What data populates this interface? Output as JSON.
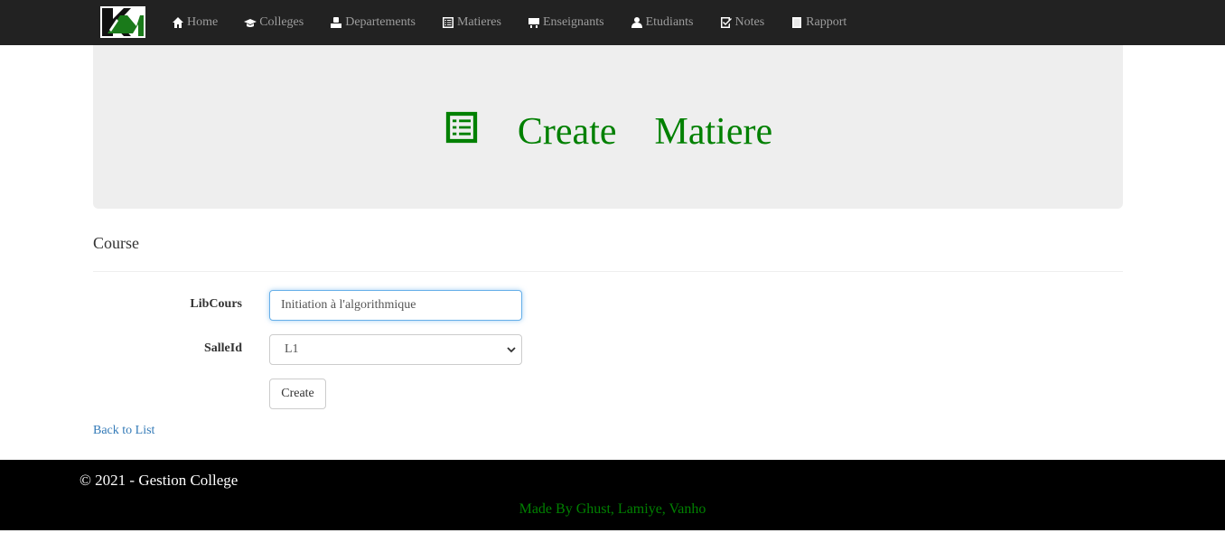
{
  "navbar": {
    "brand_logo": "KM-logo",
    "items": [
      {
        "label": "Home",
        "icon": "home-icon"
      },
      {
        "label": "Colleges",
        "icon": "graduation-cap-icon"
      },
      {
        "label": "Departements",
        "icon": "user-badge-icon"
      },
      {
        "label": "Matieres",
        "icon": "list-alt-icon"
      },
      {
        "label": "Enseignants",
        "icon": "blackboard-icon"
      },
      {
        "label": "Etudiants",
        "icon": "user-icon"
      },
      {
        "label": "Notes",
        "icon": "check-icon"
      },
      {
        "label": "Rapport",
        "icon": "book-icon"
      }
    ]
  },
  "jumbotron": {
    "icon": "list-alt-icon",
    "word1": "Create",
    "word2": "Matiere",
    "color": "#008000"
  },
  "form": {
    "heading": "Course",
    "libcours_label": "LibCours",
    "libcours_value": "Initiation à l'algorithmique",
    "salleid_label": "SalleId",
    "salleid_value": "L1",
    "submit_label": "Create"
  },
  "back_link": "Back to List",
  "footer": {
    "copyright": "© 2021 - Gestion College",
    "made_by": "Made By Ghust, Lamiye, Vanho"
  },
  "colors": {
    "navbar_bg": "#222222",
    "accent_green": "#008000",
    "link_blue": "#337ab7"
  }
}
